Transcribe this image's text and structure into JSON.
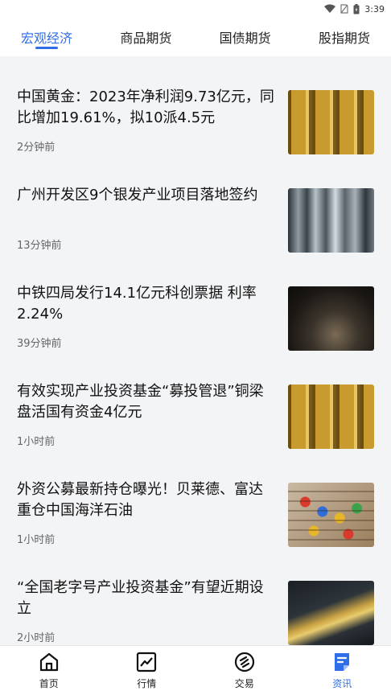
{
  "status": {
    "time": "3:39"
  },
  "tabs": [
    {
      "label": "宏观经济",
      "active": true
    },
    {
      "label": "商品期货",
      "active": false
    },
    {
      "label": "国债期货",
      "active": false
    },
    {
      "label": "股指期货",
      "active": false
    }
  ],
  "news": [
    {
      "title": "中国黄金：2023年净利润9.73亿元，同比增加19.61%，拟10派4.5元",
      "time": "2分钟前",
      "thumb": "gold-bars-image"
    },
    {
      "title": "广州开发区9个银发产业项目落地签约",
      "time": "13分钟前",
      "thumb": "silver-hair-image"
    },
    {
      "title": "中铁四局发行14.1亿元科创票据 利率2.24%",
      "time": "39分钟前",
      "thumb": "reading-book-image"
    },
    {
      "title": "有效实现产业投资基金“募投管退”铜梁盘活国有资金4亿元",
      "time": "1小时前",
      "thumb": "gold-bars-image"
    },
    {
      "title": "外资公募最新持仓曝光！贝莱德、富达重仓中国海洋石油",
      "time": "1小时前",
      "thumb": "abacus-image"
    },
    {
      "title": "“全国老字号产业投资基金”有望近期设立",
      "time": "2小时前",
      "thumb": "gold-bullion-image"
    }
  ],
  "bottom_nav": [
    {
      "label": "首页",
      "icon": "home-icon",
      "active": false
    },
    {
      "label": "行情",
      "icon": "chart-icon",
      "active": false
    },
    {
      "label": "交易",
      "icon": "trade-icon",
      "active": false
    },
    {
      "label": "资讯",
      "icon": "news-icon",
      "active": true
    }
  ],
  "colors": {
    "accent": "#2f6ee8",
    "background": "#f3f4f6"
  }
}
